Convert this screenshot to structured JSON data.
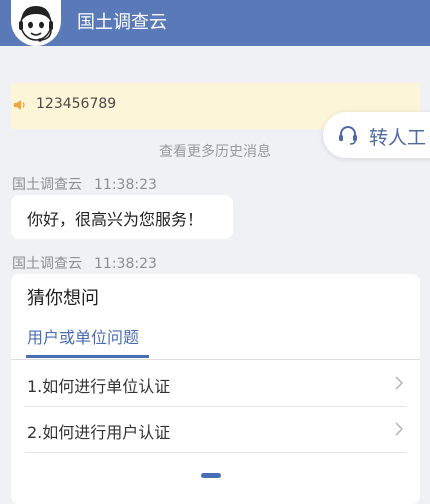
{
  "header": {
    "title": "国土调查云"
  },
  "notice": {
    "text": "123456789",
    "icon": "speaker-icon"
  },
  "transfer": {
    "label": "转人工",
    "icon": "headset-icon"
  },
  "history_link": "查看更多历史消息",
  "messages": [
    {
      "sender": "国土调查云",
      "time": "11:38:23",
      "text": "你好，很高兴为您服务！"
    },
    {
      "sender": "国土调查云",
      "time": "11:38:23"
    }
  ],
  "faq": {
    "title": "猜你想问",
    "tab": "用户或单位问题",
    "items": [
      {
        "label": "1.如何进行单位认证"
      },
      {
        "label": "2.如何进行用户认证"
      }
    ]
  },
  "colors": {
    "header": "#5a79b8",
    "accent": "#4b6db3",
    "notice_bg": "#fcf5d7"
  }
}
